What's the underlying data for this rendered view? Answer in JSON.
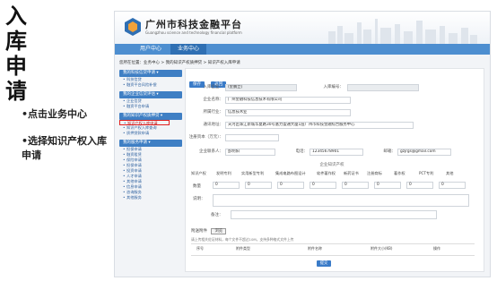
{
  "slide": {
    "title_chars": [
      "入",
      "库",
      "申",
      "请"
    ],
    "bullets": [
      "•点击业务中心",
      "•选择知识产权入库申请"
    ]
  },
  "portal": {
    "brand_cn": "广州市科技金融平台",
    "brand_en": "Guangzhou science and technology financial platform",
    "nav": [
      "用户中心",
      "业务中心"
    ],
    "breadcrumb": "您所在位置：业务中心 > 我的知识产权质押贷 > 知识产权入库申请"
  },
  "sidebar": [
    {
      "head": "我的科技信贷申请 ▾",
      "items": [
        "科技信贷",
        "融资平台风险补偿"
      ]
    },
    {
      "head": "我的企业信贷评估 ▾",
      "items": [
        "企业信贷",
        "融资平台申请"
      ]
    },
    {
      "head": "我的知识产权质押贷 ▾",
      "items": [
        "知识产权入库申请",
        "知识产权入库查询",
        "质押贷款申请"
      ]
    },
    {
      "head": "我的服务申请 ▾",
      "items": [
        "担保申请",
        "融资租赁",
        "保险申请",
        "担保申请",
        "投资申请",
        "人才申请",
        "其他申请",
        "信息申请",
        "咨询服务",
        "其他服务"
      ]
    }
  ],
  "toolbar": {
    "save": "保存",
    "back": "返回"
  },
  "form": {
    "enterprise_name_label": "入库企业：",
    "enterprise_name": "(金鹏立)",
    "enterprise_id_label": "入库编号：",
    "enterprise_id": "",
    "company_name_label": "企业名称：",
    "company_name": "广州金融科技信息技术有限公司",
    "industry_label": "所属行业：",
    "industry": "信息技术业",
    "address_label": "通讯地址：",
    "address": "天河区珠江新城华夏路30号富力盈通大厦1层广州市科技金融综合服务中心",
    "reg_capital_label": "注册资本（万元）：",
    "reg_capital": "",
    "contact_label": "企业联系人：",
    "contact": "彭明阳",
    "phone_label": "电话：",
    "phone": "12345678901",
    "email_label": "邮箱：",
    "email": "gzjrgs@gmail.com"
  },
  "ip_section": {
    "title": "企业知识产权",
    "columns": [
      "知识产权",
      "发明专利",
      "实用新型专利",
      "集成电路布图设计",
      "软件著作权",
      "新药证书",
      "注册商标",
      "著作权",
      "PCT专利",
      "其他"
    ],
    "qty_label": "数量",
    "qty_values": [
      "0",
      "0",
      "0",
      "0",
      "0",
      "0",
      "0",
      "0"
    ],
    "desc_label": "说明：",
    "remark_label": "备注："
  },
  "attachments": {
    "label": "附送附件",
    "upload": "浏览",
    "hint": "请上传相关佐证材料，每个文件不超过10M，支持多种格式文件上传",
    "columns": [
      "序号",
      "附件类型",
      "附件名称",
      "附件大小(KB)",
      "操作"
    ],
    "submit": "提交"
  }
}
